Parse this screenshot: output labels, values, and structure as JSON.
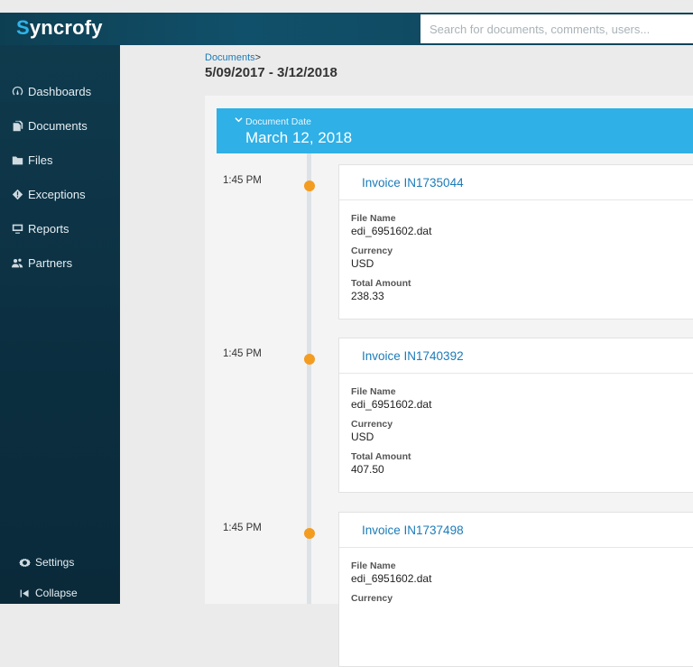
{
  "app": {
    "logo_initial": "S",
    "logo_rest": "yncrofy"
  },
  "search": {
    "placeholder": "Search for documents, comments, users..."
  },
  "sidebar": {
    "items": [
      {
        "label": "Dashboards",
        "icon": "dashboard-icon"
      },
      {
        "label": "Documents",
        "icon": "documents-icon"
      },
      {
        "label": "Files",
        "icon": "files-icon"
      },
      {
        "label": "Exceptions",
        "icon": "exceptions-icon"
      },
      {
        "label": "Reports",
        "icon": "reports-icon"
      },
      {
        "label": "Partners",
        "icon": "partners-icon"
      }
    ],
    "bottom": [
      {
        "label": "Settings",
        "icon": "gear-icon"
      },
      {
        "label": "Collapse",
        "icon": "collapse-icon"
      }
    ]
  },
  "breadcrumb": {
    "parent": "Documents",
    "separator": ">"
  },
  "date_range": "5/09/2017 - 3/12/2018",
  "group": {
    "label": "Document Date",
    "value": "March 12, 2018"
  },
  "colors": {
    "accent": "#2fb0e6",
    "dot": "#f39c1f",
    "link": "#1b7bb8",
    "sidebar": "#0f3a4d"
  },
  "entries": [
    {
      "time": "1:45 PM",
      "title": "Invoice IN1735044",
      "fields": [
        {
          "label": "File Name",
          "value": "edi_6951602.dat"
        },
        {
          "label": "Currency",
          "value": "USD"
        },
        {
          "label": "Total Amount",
          "value": "238.33"
        }
      ]
    },
    {
      "time": "1:45 PM",
      "title": "Invoice IN1740392",
      "fields": [
        {
          "label": "File Name",
          "value": "edi_6951602.dat"
        },
        {
          "label": "Currency",
          "value": "USD"
        },
        {
          "label": "Total Amount",
          "value": "407.50"
        }
      ]
    },
    {
      "time": "1:45 PM",
      "title": "Invoice IN1737498",
      "fields": [
        {
          "label": "File Name",
          "value": "edi_6951602.dat"
        },
        {
          "label": "Currency",
          "value": ""
        }
      ]
    }
  ]
}
